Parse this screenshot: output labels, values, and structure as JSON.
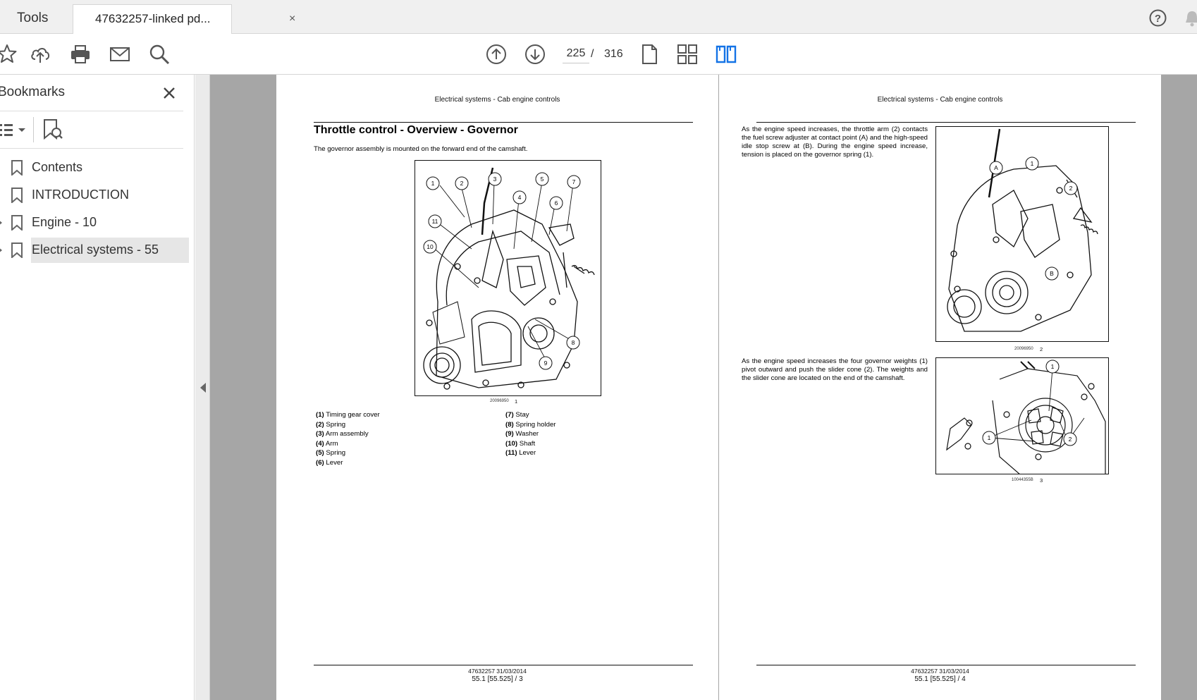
{
  "tabs": {
    "tools_label": "Tools",
    "document_label": "47632257-linked pd...",
    "close_glyph": "×"
  },
  "toolbar": {
    "icons": [
      "bookmark-star-icon",
      "upload-cloud-icon",
      "print-icon",
      "mail-icon",
      "zoom-icon",
      "prev-page-icon",
      "next-page-icon",
      "single-page-icon",
      "page-thumbnails-icon",
      "two-page-icon"
    ],
    "current_page": "225",
    "separator": "/",
    "total_pages": "316",
    "accent_color": "#1473e6"
  },
  "sidebar": {
    "title": "Bookmarks",
    "items": [
      {
        "label": "Contents",
        "expandable": false,
        "selected": false
      },
      {
        "label": "INTRODUCTION",
        "expandable": false,
        "selected": false
      },
      {
        "label": "Engine - 10",
        "expandable": true,
        "selected": false
      },
      {
        "label": "Electrical systems - 55",
        "expandable": true,
        "selected": true
      }
    ]
  },
  "pages": {
    "left": {
      "header": "Electrical systems - Cab engine controls",
      "title": "Throttle control - Overview - Governor",
      "intro": "The governor assembly is mounted on the forward end of the camshaft.",
      "figure": {
        "caption": "20096950",
        "number": "1",
        "callouts": [
          "1",
          "2",
          "3",
          "4",
          "5",
          "6",
          "7",
          "8",
          "9",
          "10",
          "11"
        ]
      },
      "legend_left": [
        {
          "num": "(1)",
          "text": "Timing gear cover"
        },
        {
          "num": "(2)",
          "text": "Spring"
        },
        {
          "num": "(3)",
          "text": "Arm assembly"
        },
        {
          "num": "(4)",
          "text": "Arm"
        },
        {
          "num": "(5)",
          "text": "Spring"
        },
        {
          "num": "(6)",
          "text": "Lever"
        }
      ],
      "legend_right": [
        {
          "num": "(7)",
          "text": "Stay"
        },
        {
          "num": "(8)",
          "text": "Spring holder"
        },
        {
          "num": "(9)",
          "text": "Washer"
        },
        {
          "num": "(10)",
          "text": "Shaft"
        },
        {
          "num": "(11)",
          "text": "Lever"
        }
      ],
      "footer_line1": "47632257 31/03/2014",
      "footer_line2": "55.1 [55.525] / 3"
    },
    "right": {
      "header": "Electrical systems - Cab engine controls",
      "para1": "As the engine speed increases, the throttle arm (2) contacts the fuel screw adjuster at contact point (A) and the high-speed idle stop screw at (B). During the engine speed increase, tension is placed on the governor spring (1).",
      "para2": "As the engine speed increases the four governor weights (1) pivot outward and push the slider cone (2). The weights and the slider cone are located on the end of the camshaft.",
      "figure2": {
        "caption": "20096950",
        "number": "2",
        "callouts": [
          "A",
          "1",
          "2",
          "B"
        ]
      },
      "figure3": {
        "caption": "10044355B",
        "number": "3",
        "callouts": [
          "1",
          "1",
          "2"
        ]
      },
      "footer_line1": "47632257 31/03/2014",
      "footer_line2": "55.1 [55.525] / 4"
    }
  }
}
